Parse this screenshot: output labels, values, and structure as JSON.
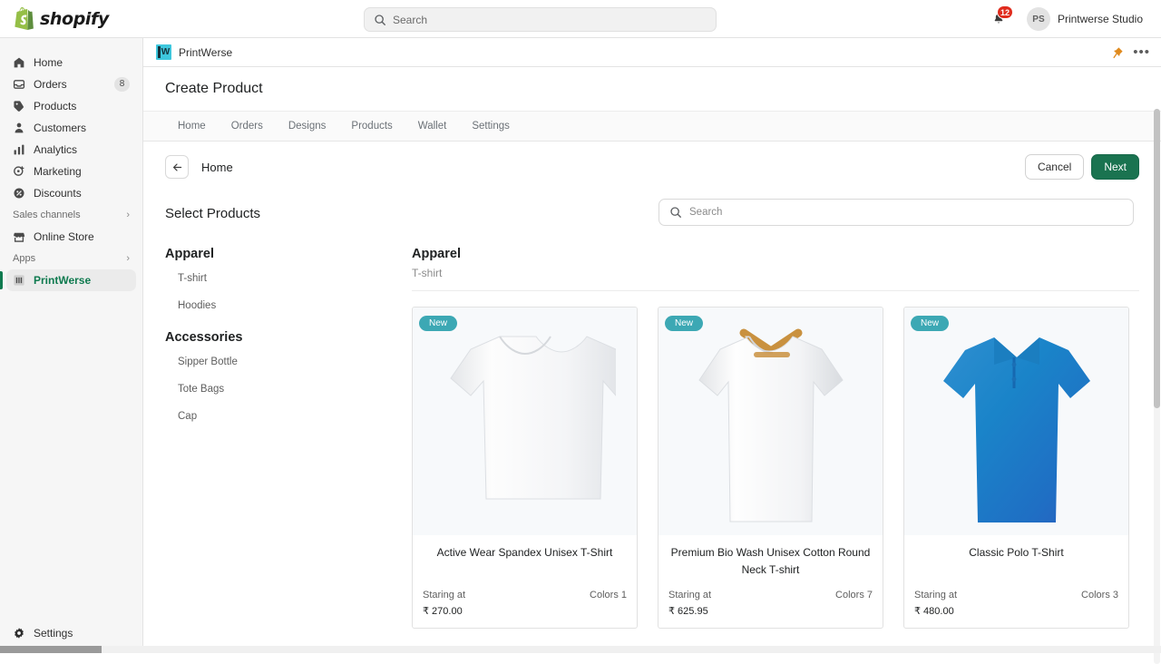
{
  "topbar": {
    "brand_name": "shopify",
    "search_placeholder": "Search",
    "notification_count": "12",
    "avatar_initials": "PS",
    "user_name": "Printwerse Studio"
  },
  "sidebar": {
    "items": [
      {
        "label": "Home",
        "icon": "home-icon",
        "count": ""
      },
      {
        "label": "Orders",
        "icon": "orders-icon",
        "count": "8"
      },
      {
        "label": "Products",
        "icon": "products-icon",
        "count": ""
      },
      {
        "label": "Customers",
        "icon": "customers-icon",
        "count": ""
      },
      {
        "label": "Analytics",
        "icon": "analytics-icon",
        "count": ""
      },
      {
        "label": "Marketing",
        "icon": "marketing-icon",
        "count": ""
      },
      {
        "label": "Discounts",
        "icon": "discounts-icon",
        "count": ""
      }
    ],
    "sales_channels_label": "Sales channels",
    "online_store_label": "Online Store",
    "apps_label": "Apps",
    "app_item_label": "PrintWerse",
    "settings_label": "Settings"
  },
  "app": {
    "logo_letter": "W",
    "name": "PrintWerse",
    "page_title": "Create Product",
    "tabs": [
      {
        "label": "Home"
      },
      {
        "label": "Orders"
      },
      {
        "label": "Designs"
      },
      {
        "label": "Products"
      },
      {
        "label": "Wallet"
      },
      {
        "label": "Settings"
      }
    ],
    "breadcrumb": "Home",
    "cancel_label": "Cancel",
    "next_label": "Next",
    "section_title": "Select Products",
    "search_placeholder": "Search"
  },
  "categories": [
    {
      "group": "Apparel",
      "items": [
        {
          "label": "T-shirt"
        },
        {
          "label": "Hoodies"
        }
      ]
    },
    {
      "group": "Accessories",
      "items": [
        {
          "label": "Sipper Bottle"
        },
        {
          "label": "Tote Bags"
        },
        {
          "label": "Cap"
        }
      ]
    }
  ],
  "grid": {
    "heading": "Apparel",
    "subheading": "T-shirt",
    "badge_label": "New",
    "starting_label": "Staring at",
    "products": [
      {
        "name": "Active Wear Spandex Unisex T-Shirt",
        "price": "₹ 270.00",
        "colors": "Colors 1",
        "badge": "New",
        "image": "white-crew-tshirt",
        "color_hex": "#f2f3f5"
      },
      {
        "name": "Premium Bio Wash Unisex Cotton Round Neck T-shirt",
        "price": "₹ 625.95",
        "colors": "Colors 7",
        "badge": "New",
        "image": "white-tshirt-on-hanger",
        "color_hex": "#ebecee"
      },
      {
        "name": "Classic Polo T-Shirt",
        "price": "₹ 480.00",
        "colors": "Colors 3",
        "badge": "New",
        "image": "blue-polo-shirt",
        "color_hex": "#1b7fc4"
      }
    ]
  },
  "colors": {
    "shopify_green": "#0f7a4f",
    "primary_button": "#1a7350",
    "badge_teal": "#3ca8b4",
    "notification_red": "#e02c1d",
    "app_logo_cyan": "#3ec7dd"
  }
}
